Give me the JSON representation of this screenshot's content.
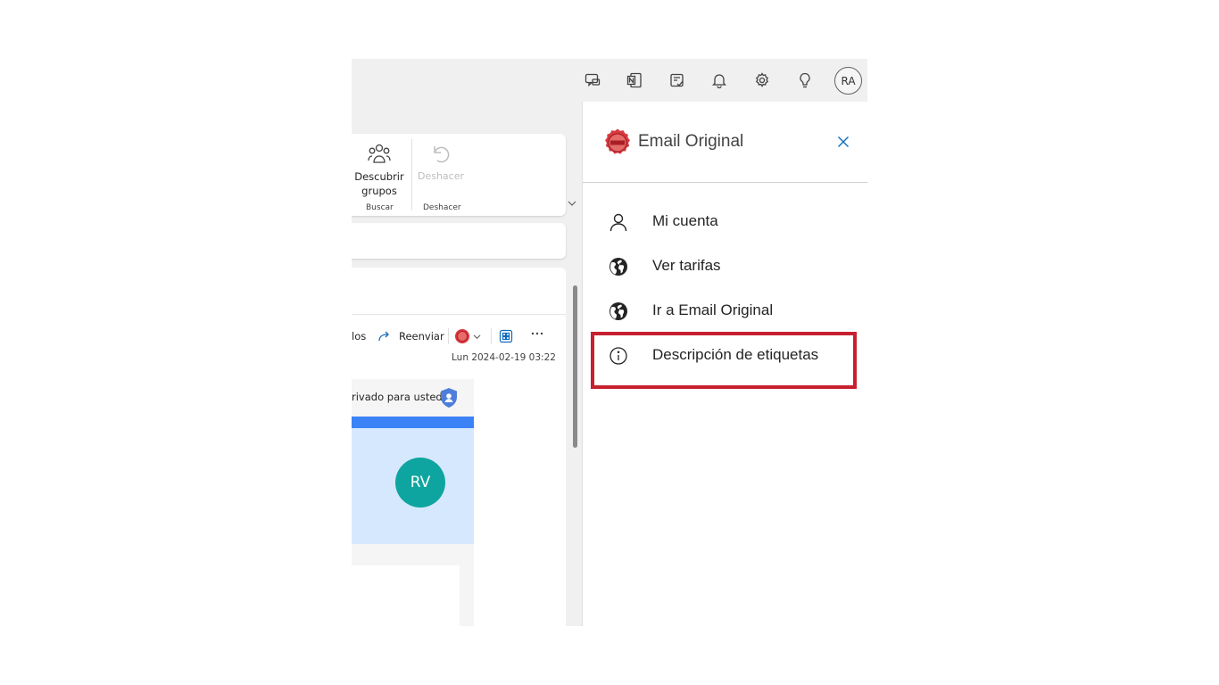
{
  "header": {
    "avatar_initials": "RA",
    "icons": [
      "chat-feedback-icon",
      "onenote-icon",
      "todo-icon",
      "bell-icon",
      "gear-icon",
      "lightbulb-icon"
    ]
  },
  "ribbon": {
    "discover_label_1": "Descubrir",
    "discover_label_2": "grupos",
    "search_group": "Buscar",
    "undo_label": "Deshacer",
    "undo_group": "Deshacer"
  },
  "reading": {
    "reply_fragment": "los",
    "forward_label": "Reenviar",
    "date": "Lun 2024-02-19 03:22",
    "private_text": "rivado para usted",
    "sender_initials": "RV"
  },
  "panel": {
    "title": "Email Original",
    "items": [
      {
        "label": "Mi cuenta",
        "icon": "person-icon"
      },
      {
        "label": "Ver tarifas",
        "icon": "globe-icon"
      },
      {
        "label": "Ir a Email Original",
        "icon": "globe-icon"
      },
      {
        "label": "Descripción de etiquetas",
        "icon": "info-icon"
      }
    ]
  },
  "colors": {
    "accent": "#0f6cbd",
    "highlight": "#c8202f",
    "avatar_rv": "#0ea5a0"
  }
}
